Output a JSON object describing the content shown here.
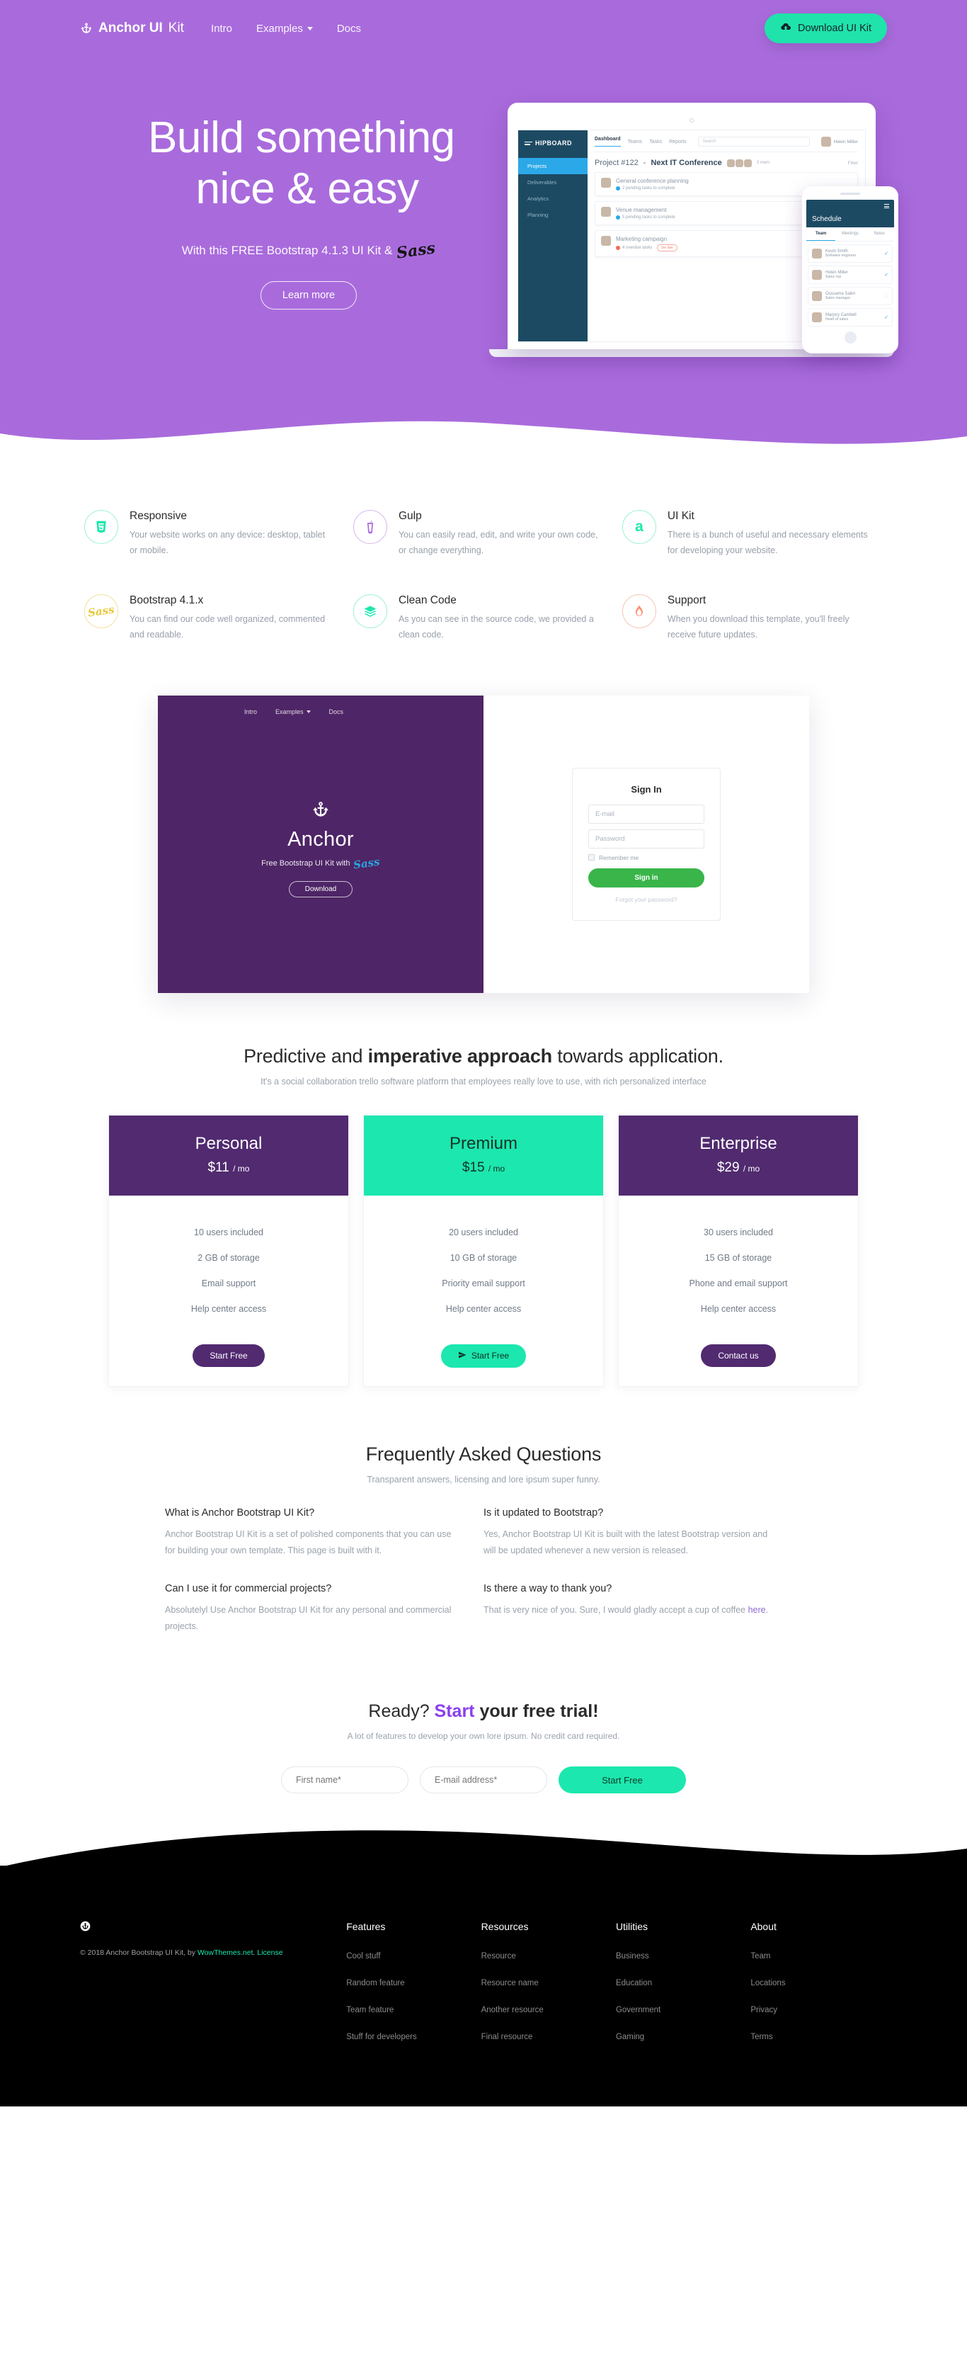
{
  "nav": {
    "brand_bold": "Anchor UI",
    "brand_light": "Kit",
    "brand_icon": "anchor-icon",
    "links": [
      {
        "label": "Intro",
        "caret": false
      },
      {
        "label": "Examples",
        "caret": true
      },
      {
        "label": "Docs",
        "caret": false
      }
    ],
    "download_label": "Download UI Kit",
    "download_icon": "cloud-download-icon"
  },
  "hero": {
    "title_line1": "Build something",
    "title_line2": "nice & easy",
    "subtitle": "With this FREE Bootstrap 4.1.3 UI Kit &",
    "subtitle_mark": "Sass",
    "cta_label": "Learn more",
    "bg_color": "#a96bdc"
  },
  "mockup": {
    "logo": "HIPBOARD",
    "sidebar": [
      "Projects",
      "Deliverables",
      "Analytics",
      "Planning"
    ],
    "tabs": [
      "Dashboard",
      "Teams",
      "Tasks",
      "Reports"
    ],
    "search_placeholder": "Search",
    "user": "Helen Miller",
    "project_prefix": "Project #122",
    "project_name": "Next IT Conference",
    "members_label": "3 mem",
    "filter_label": "Filter",
    "tasks": [
      {
        "title": "General conference planning",
        "status": "2 pending tasks to complete",
        "state": "ok",
        "badge": ""
      },
      {
        "title": "Venue management",
        "status": "5 pending tasks to complete",
        "state": "ok",
        "badge": ""
      },
      {
        "title": "Marketing campaign",
        "status": "4 overdue tasks",
        "state": "bad",
        "badge": "too late"
      }
    ],
    "phone": {
      "title": "Schedule",
      "tabs": [
        "Team",
        "Meetings",
        "Notes"
      ],
      "people": [
        {
          "name": "Kevin Smith",
          "role": "Software engineer",
          "checked": true
        },
        {
          "name": "Helen Miller",
          "role": "Sales rep",
          "checked": true
        },
        {
          "name": "Oussama Salim",
          "role": "Sales manager",
          "checked": false
        },
        {
          "name": "Marjory Cambell",
          "role": "Head of sales",
          "checked": true
        }
      ]
    }
  },
  "features": [
    {
      "title": "Responsive",
      "desc": "Your website works on any device: desktop, tablet or mobile.",
      "icon": "html5-icon",
      "glyph": "5",
      "color": "#1ce7ae"
    },
    {
      "title": "Gulp",
      "desc": "You can easily read, edit, and write your own code, or change everything.",
      "icon": "gulp-cup-icon",
      "glyph": "⛾",
      "color": "#a96bdc"
    },
    {
      "title": "UI Kit",
      "desc": "There is a bunch of useful and necessary elements for developing your website.",
      "icon": "anchor-a-icon",
      "glyph": "a",
      "color": "#1ce7ae"
    },
    {
      "title": "Bootstrap 4.1.x",
      "desc": "You can find our code well organized, commented and readable.",
      "icon": "sass-icon",
      "glyph": "Sass",
      "color": "#e8c83c"
    },
    {
      "title": "Clean Code",
      "desc": "As you can see in the source code, we provided a clean code.",
      "icon": "layers-icon",
      "glyph": "≣",
      "color": "#1ce7ae"
    },
    {
      "title": "Support",
      "desc": "When you download this template, you'll freely receive future updates.",
      "icon": "flame-icon",
      "glyph": "●",
      "color": "#ff8a6b"
    }
  ],
  "showcase": {
    "nav": [
      {
        "label": "Intro",
        "caret": false
      },
      {
        "label": "Examples",
        "caret": true
      },
      {
        "label": "Docs",
        "caret": false
      }
    ],
    "anchor_icon": "anchor-icon",
    "name": "Anchor",
    "tagline": "Free Bootstrap UI Kit with",
    "tagline_mark": "Sass",
    "download_label": "Download",
    "signin": {
      "title": "Sign In",
      "email_placeholder": "E-mail",
      "password_placeholder": "Password",
      "remember_label": "Remember me",
      "submit_label": "Sign in",
      "forgot_label": "Forgot your password?"
    }
  },
  "approach": {
    "title_a": "Predictive and ",
    "title_b": "imperative approach",
    "title_c": " towards application.",
    "subtitle": "It's a social collaboration trello software platform that employees really love to use, with rich personalized interface"
  },
  "pricing": [
    {
      "name": "Personal",
      "price": "$11",
      "period": "/ mo",
      "theme": "purple",
      "features": [
        "10 users included",
        "2 GB of storage",
        "Email support",
        "Help center access"
      ],
      "cta": "Start Free",
      "cta_theme": "purple",
      "cta_icon": ""
    },
    {
      "name": "Premium",
      "price": "$15",
      "period": "/ mo",
      "theme": "teal",
      "features": [
        "20 users included",
        "10 GB of storage",
        "Priority email support",
        "Help center access"
      ],
      "cta": "Start Free",
      "cta_theme": "teal",
      "cta_icon": "send-icon"
    },
    {
      "name": "Enterprise",
      "price": "$29",
      "period": "/ mo",
      "theme": "purple",
      "features": [
        "30 users included",
        "15 GB of storage",
        "Phone and email support",
        "Help center access"
      ],
      "cta": "Contact us",
      "cta_theme": "purple",
      "cta_icon": ""
    }
  ],
  "faq": {
    "title": "Frequently Asked Questions",
    "subtitle": "Transparent answers, licensing and lore ipsum super funny.",
    "items": [
      {
        "q": "What is Anchor Bootstrap UI Kit?",
        "a": "Anchor Bootstrap UI Kit is a set of polished components that you can use for building your own template. This page is built with it.",
        "link": ""
      },
      {
        "q": "Is it updated to Bootstrap?",
        "a": "Yes, Anchor Bootstrap UI Kit is built with the latest Bootstrap version and will be updated whenever a new version is released.",
        "link": ""
      },
      {
        "q": "Can I use it for commercial projects?",
        "a": "Absolutelyl Use Anchor Bootstrap UI Kit for any personal and commercial projects.",
        "link": ""
      },
      {
        "q": "Is there a way to thank you?",
        "a": "That is very nice of you. Sure, I would gladly accept a cup of coffee ",
        "link": "here",
        "a_tail": "."
      }
    ]
  },
  "cta": {
    "title_a": "Ready? ",
    "title_hl": "Start",
    "title_b": " your free trial!",
    "subtitle": "A lot of features to develop your own lore ipsum. No credit card required.",
    "firstname_placeholder": "First name*",
    "email_placeholder": "E-mail address*",
    "button_label": "Start Free"
  },
  "footer": {
    "icon": "anchor-circle-icon",
    "copy_a": "© 2018 Anchor Bootstrap UI Kit, by ",
    "copy_link": "WowThemes.net",
    "copy_b": ".",
    "license_label": "License",
    "columns": [
      {
        "title": "Features",
        "items": [
          "Cool stuff",
          "Random feature",
          "Team feature",
          "Stuff for developers"
        ]
      },
      {
        "title": "Resources",
        "items": [
          "Resource",
          "Resource name",
          "Another resource",
          "Final resource"
        ]
      },
      {
        "title": "Utilities",
        "items": [
          "Business",
          "Education",
          "Government",
          "Gaming"
        ]
      },
      {
        "title": "About",
        "items": [
          "Team",
          "Locations",
          "Privacy",
          "Terms"
        ]
      }
    ]
  }
}
